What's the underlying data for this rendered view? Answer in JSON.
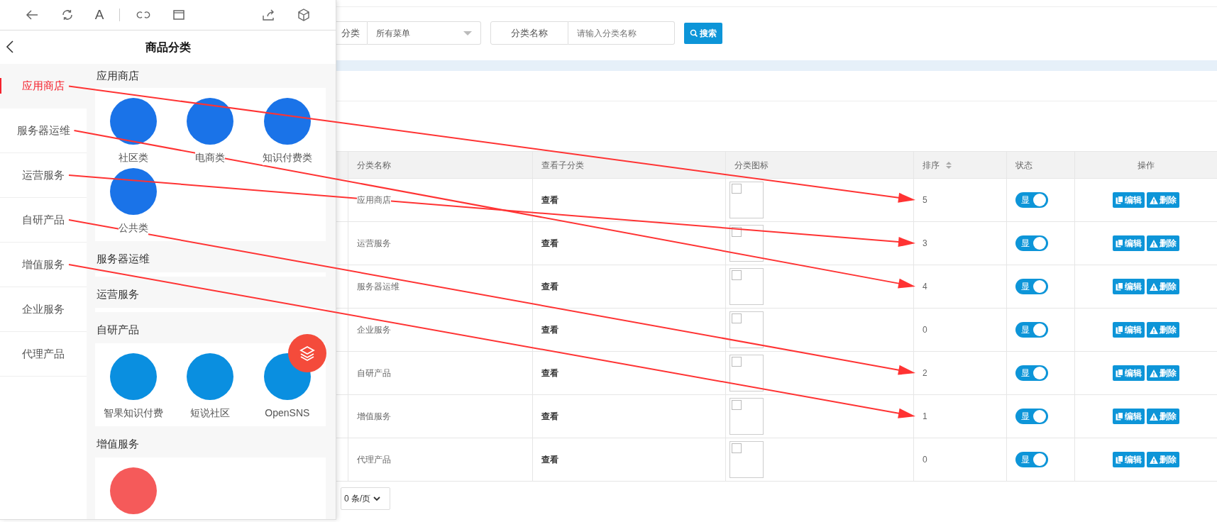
{
  "browser_toolbar": {
    "font_button": "A"
  },
  "mobile_page": {
    "title": "商品分类",
    "sidebar": {
      "items": [
        {
          "label": "应用商店",
          "selected": true
        },
        {
          "label": "服务器运维",
          "selected": false
        },
        {
          "label": "运营服务",
          "selected": false
        },
        {
          "label": "自研产品",
          "selected": false
        },
        {
          "label": "增值服务",
          "selected": false
        },
        {
          "label": "企业服务",
          "selected": false
        },
        {
          "label": "代理产品",
          "selected": false
        }
      ]
    },
    "sections": [
      {
        "title": "应用商店",
        "products": [
          {
            "name": "社区类",
            "color": "#1a73e8"
          },
          {
            "name": "电商类",
            "color": "#1a73e8"
          },
          {
            "name": "知识付费类",
            "color": "#1a73e8"
          },
          {
            "name": "公共类",
            "color": "#1a73e8"
          }
        ]
      },
      {
        "title": "服务器运维"
      },
      {
        "title": "运营服务"
      },
      {
        "title": "自研产品",
        "products": [
          {
            "name": "智果知识付费",
            "color": "#0a8fe0"
          },
          {
            "name": "短说社区",
            "color": "#0a8fe0"
          },
          {
            "name": "OpenSNS",
            "color": "#0a8fe0"
          }
        ]
      },
      {
        "title": "增值服务",
        "products": [
          {
            "color": "#f55a5a"
          }
        ]
      }
    ]
  },
  "filters": {
    "category_label": "分类",
    "category_value": "所有菜单",
    "name_label": "分类名称",
    "name_placeholder": "请输入分类名称",
    "search_button": "搜索"
  },
  "table": {
    "columns": [
      {
        "label": "分类名称",
        "sortable": false
      },
      {
        "label": "查看子分类",
        "sortable": false
      },
      {
        "label": "分类图标",
        "sortable": false
      },
      {
        "label": "排序",
        "sortable": true
      },
      {
        "label": "状态",
        "sortable": false
      },
      {
        "label": "操作",
        "sortable": false
      }
    ],
    "rows": [
      {
        "name": "应用商店",
        "view": "查看",
        "sort": "5",
        "status": "显",
        "on": true,
        "edit": "编辑",
        "delete": "删除"
      },
      {
        "name": "运营服务",
        "view": "查看",
        "sort": "3",
        "status": "显",
        "on": true,
        "edit": "编辑",
        "delete": "删除"
      },
      {
        "name": "服务器运维",
        "view": "查看",
        "sort": "4",
        "status": "显",
        "on": true,
        "edit": "编辑",
        "delete": "删除"
      },
      {
        "name": "企业服务",
        "view": "查看",
        "sort": "0",
        "status": "显",
        "on": true,
        "edit": "编辑",
        "delete": "删除"
      },
      {
        "name": "自研产品",
        "view": "查看",
        "sort": "2",
        "status": "显",
        "on": true,
        "edit": "编辑",
        "delete": "删除"
      },
      {
        "name": "增值服务",
        "view": "查看",
        "sort": "1",
        "status": "显",
        "on": true,
        "edit": "编辑",
        "delete": "删除"
      },
      {
        "name": "代理产品",
        "view": "查看",
        "sort": "0",
        "status": "显",
        "on": true,
        "edit": "编辑",
        "delete": "删除"
      }
    ]
  },
  "pagination": {
    "page_size": "0 条/页"
  },
  "annotations": [
    {
      "kind": "arrow"
    },
    {
      "kind": "arrow"
    },
    {
      "kind": "arrow"
    },
    {
      "kind": "arrow"
    },
    {
      "kind": "arrow"
    }
  ]
}
